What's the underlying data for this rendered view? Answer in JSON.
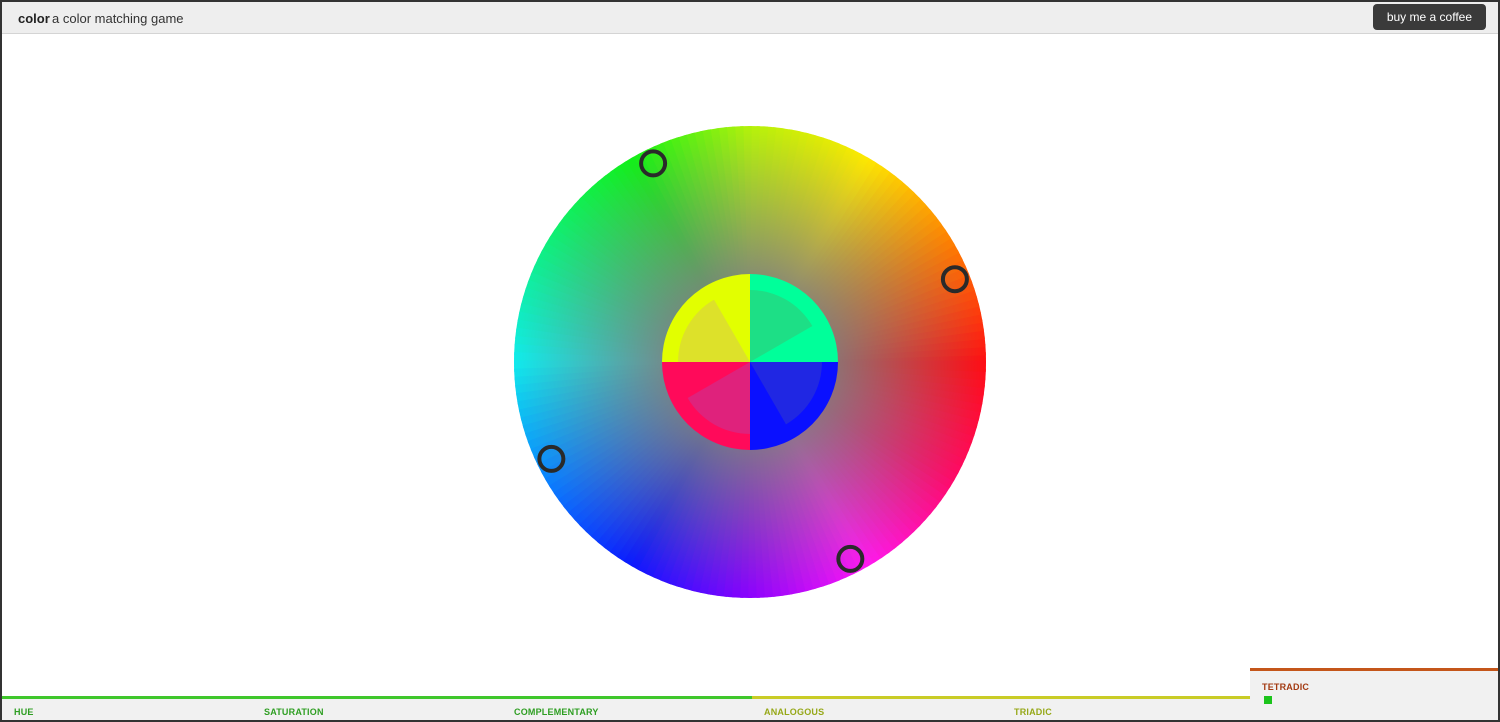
{
  "header": {
    "brand": "color",
    "tagline": "a color matching game",
    "coffee_label": "buy me a coffee"
  },
  "wheel": {
    "outer_colors": [
      "#ff0d12",
      "#ff7a00",
      "#ffe800",
      "#b6f20a",
      "#12f016",
      "#0ef07c",
      "#10ecec",
      "#0a84ff",
      "#0a18ff",
      "#8a00ff",
      "#ff18f2",
      "#ff0a6a"
    ],
    "center_quadrants": [
      {
        "name": "top-left",
        "outer": "#e2ff00",
        "inner": "#dde12a"
      },
      {
        "name": "top-right",
        "outer": "#00ff9a",
        "inner": "#1ddf86"
      },
      {
        "name": "bottom-left",
        "outer": "#ff0a5a",
        "inner": "#df227c"
      },
      {
        "name": "bottom-right",
        "outer": "#0a10ff",
        "inner": "#2027e3"
      }
    ],
    "handles": [
      {
        "name": "handle-1",
        "angle_deg": 22
      },
      {
        "name": "handle-2",
        "angle_deg": 116
      },
      {
        "name": "handle-3",
        "angle_deg": 206
      },
      {
        "name": "handle-4",
        "angle_deg": 297
      }
    ]
  },
  "levels": [
    {
      "name": "hue",
      "label": "HUE",
      "color": "#2e9e22",
      "status": "done"
    },
    {
      "name": "saturation",
      "label": "SATURATION",
      "color": "#2e9e22",
      "status": "done"
    },
    {
      "name": "complementary",
      "label": "COMPLEMENTARY",
      "color": "#2e9e22",
      "status": "done"
    },
    {
      "name": "analogous",
      "label": "ANALOGOUS",
      "color": "#96a818",
      "status": "done"
    },
    {
      "name": "triadic",
      "label": "TRIADIC",
      "color": "#96a818",
      "status": "done"
    },
    {
      "name": "tetradic",
      "label": "TETRADIC",
      "color": "#a33a12",
      "status": "active",
      "progress_color": "#1cc41c"
    }
  ],
  "colors": {
    "accent_done": "#3fc72b",
    "accent_partial": "#c9cc26",
    "accent_active": "#c4561a"
  }
}
